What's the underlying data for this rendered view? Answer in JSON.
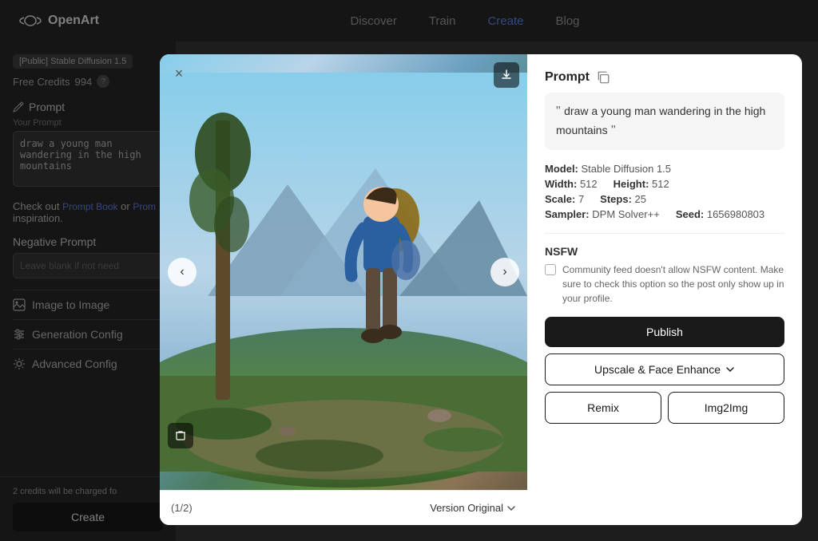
{
  "nav": {
    "logo_text": "OpenArt",
    "links": [
      {
        "label": "Discover",
        "active": false
      },
      {
        "label": "Train",
        "active": false
      },
      {
        "label": "Create",
        "active": true
      },
      {
        "label": "Blog",
        "active": false
      }
    ]
  },
  "sidebar": {
    "model_badge": "[Public] Stable Diffusion 1.5",
    "credits_label": "Free Credits",
    "credits_value": "994",
    "prompt_section": {
      "title": "Prompt",
      "placeholder": "Your Prompt",
      "value": "draw a young man wandering in the high mountains"
    },
    "prompt_link_text": "Check out",
    "prompt_book_link": "Prompt Book",
    "prompt_or": "or",
    "prompt_inspiration_link": "Prom",
    "prompt_inspiration_suffix": "inspiration.",
    "negative_prompt": {
      "title": "Negative Prompt",
      "placeholder": "Leave blank if not need"
    },
    "menu_items": [
      {
        "icon": "image-icon",
        "label": "Image to Image"
      },
      {
        "icon": "sliders-icon",
        "label": "Generation Config"
      },
      {
        "icon": "gear-icon",
        "label": "Advanced Config"
      }
    ],
    "credits_warning": "2 credits will be charged fo",
    "create_button": "Create"
  },
  "modal": {
    "close_label": "×",
    "image_counter": "(1/2)",
    "version_label": "Version Original",
    "download_tooltip": "Download",
    "delete_tooltip": "Delete",
    "right_panel": {
      "prompt_label": "Prompt",
      "prompt_text": "draw a young man wandering in the high mountains",
      "meta": {
        "model_label": "Model:",
        "model_value": "Stable Diffusion 1.5",
        "width_label": "Width:",
        "width_value": "512",
        "height_label": "Height:",
        "height_value": "512",
        "scale_label": "Scale:",
        "scale_value": "7",
        "steps_label": "Steps:",
        "steps_value": "25",
        "sampler_label": "Sampler:",
        "sampler_value": "DPM Solver++",
        "seed_label": "Seed:",
        "seed_value": "1656980803"
      },
      "nsfw": {
        "title": "NSFW",
        "description": "Community feed doesn't allow NSFW content. Make sure to check this option so the post only show up in your profile."
      },
      "buttons": {
        "publish": "Publish",
        "upscale": "Upscale & Face Enhance",
        "remix": "Remix",
        "img2img": "Img2Img"
      }
    }
  }
}
